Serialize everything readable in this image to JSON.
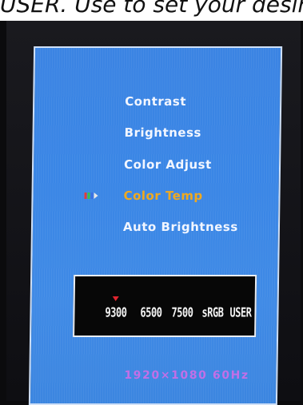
{
  "caption": "USER. Use to set your desir",
  "menu": {
    "items": [
      {
        "label": "Contrast",
        "active": false
      },
      {
        "label": "Brightness",
        "active": false
      },
      {
        "label": "Color  Adjust",
        "active": false
      },
      {
        "label": "Color  Temp",
        "active": true
      },
      {
        "label": "Auto  Brightness",
        "active": false
      }
    ],
    "pointer_icon": "active-item-arrow-icon"
  },
  "color_temp": {
    "options": [
      "9300",
      "6500",
      "7500",
      "sRGB",
      "USER"
    ],
    "selected": "9300",
    "marker_icon": "red-triangle-marker-icon",
    "marker_color": "#e0242e"
  },
  "status": {
    "resolution": "1920×1080  60Hz"
  },
  "colors": {
    "osd_background": "#3a86e6",
    "active_item": "#f0a91e",
    "resolution_text": "#c26fe7"
  }
}
